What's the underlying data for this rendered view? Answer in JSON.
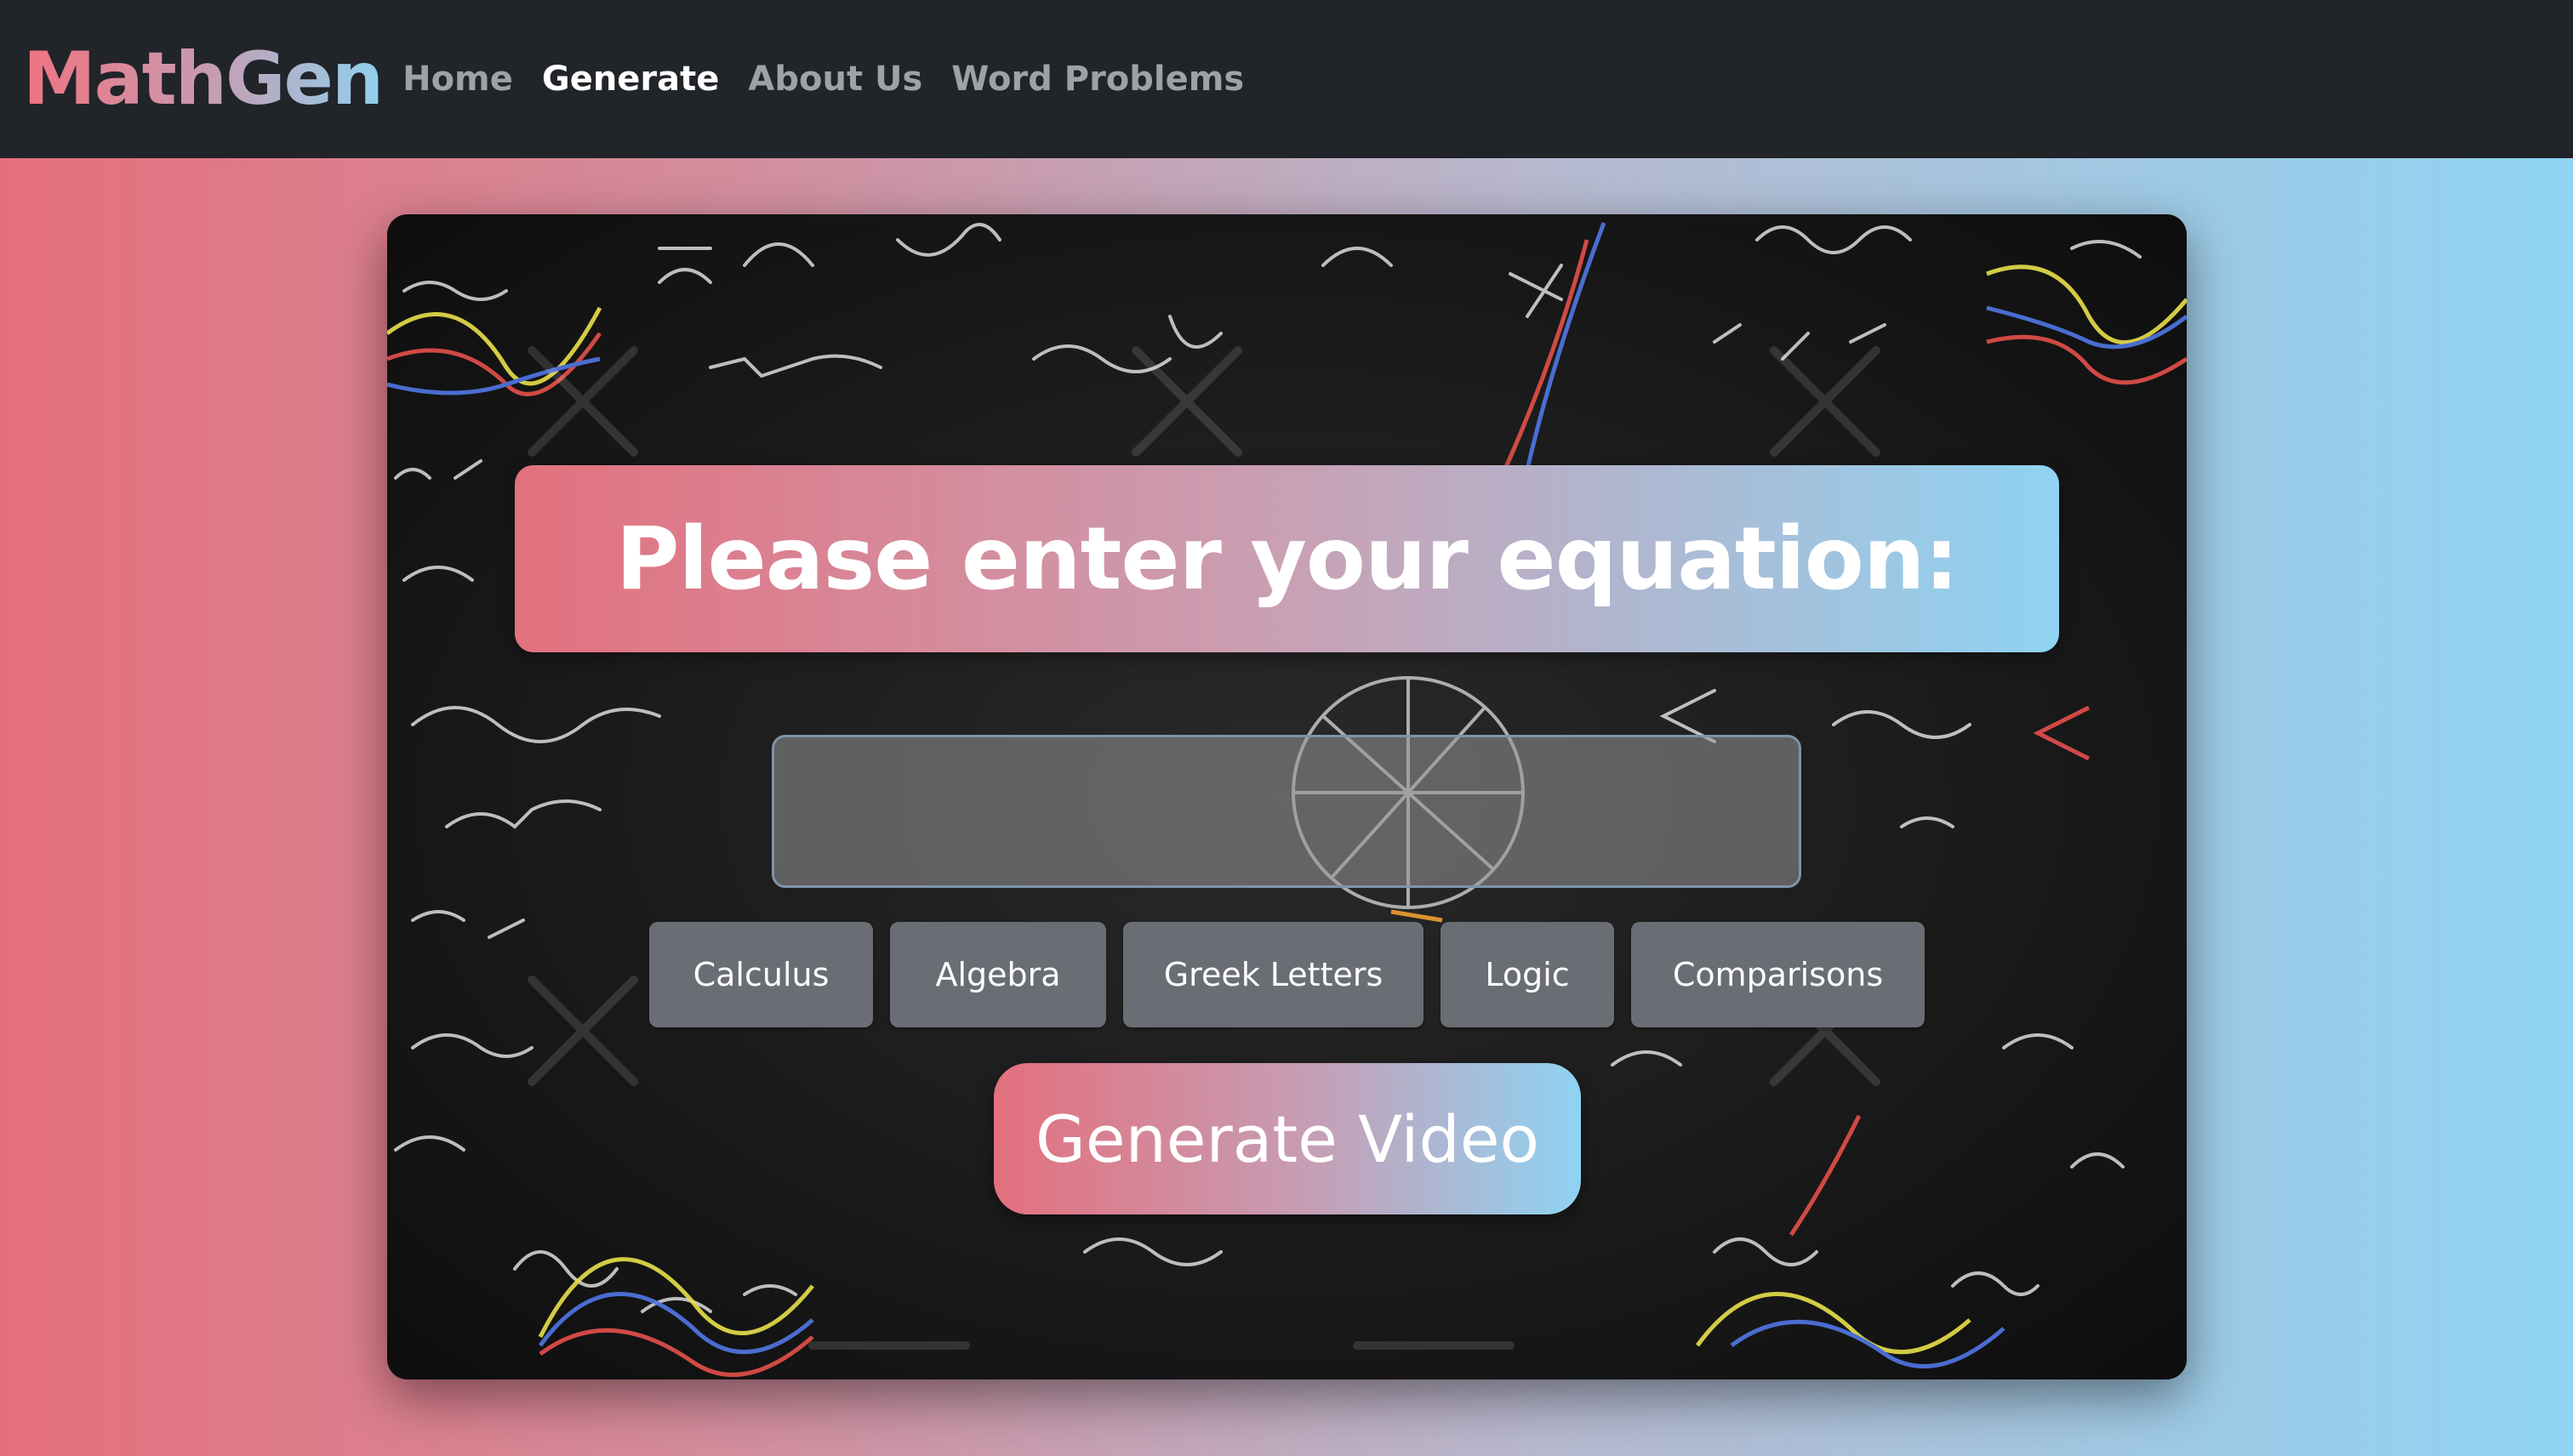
{
  "navbar": {
    "brand": "MathGen",
    "links": [
      {
        "label": "Home",
        "active": false
      },
      {
        "label": "Generate",
        "active": true
      },
      {
        "label": "About Us",
        "active": false
      },
      {
        "label": "Word Problems",
        "active": false
      }
    ]
  },
  "main": {
    "headline": "Please enter your equation:",
    "equation_input": {
      "value": "",
      "placeholder": ""
    },
    "categories": [
      {
        "label": "Calculus"
      },
      {
        "label": "Algebra"
      },
      {
        "label": "Greek Letters"
      },
      {
        "label": "Logic"
      },
      {
        "label": "Comparisons"
      }
    ],
    "generate_label": "Generate Video"
  },
  "colors": {
    "navbar_bg": "#212429",
    "gradient_start": "#e66f7c",
    "gradient_end": "#8fd4f3",
    "category_button": "#6a6e74"
  }
}
